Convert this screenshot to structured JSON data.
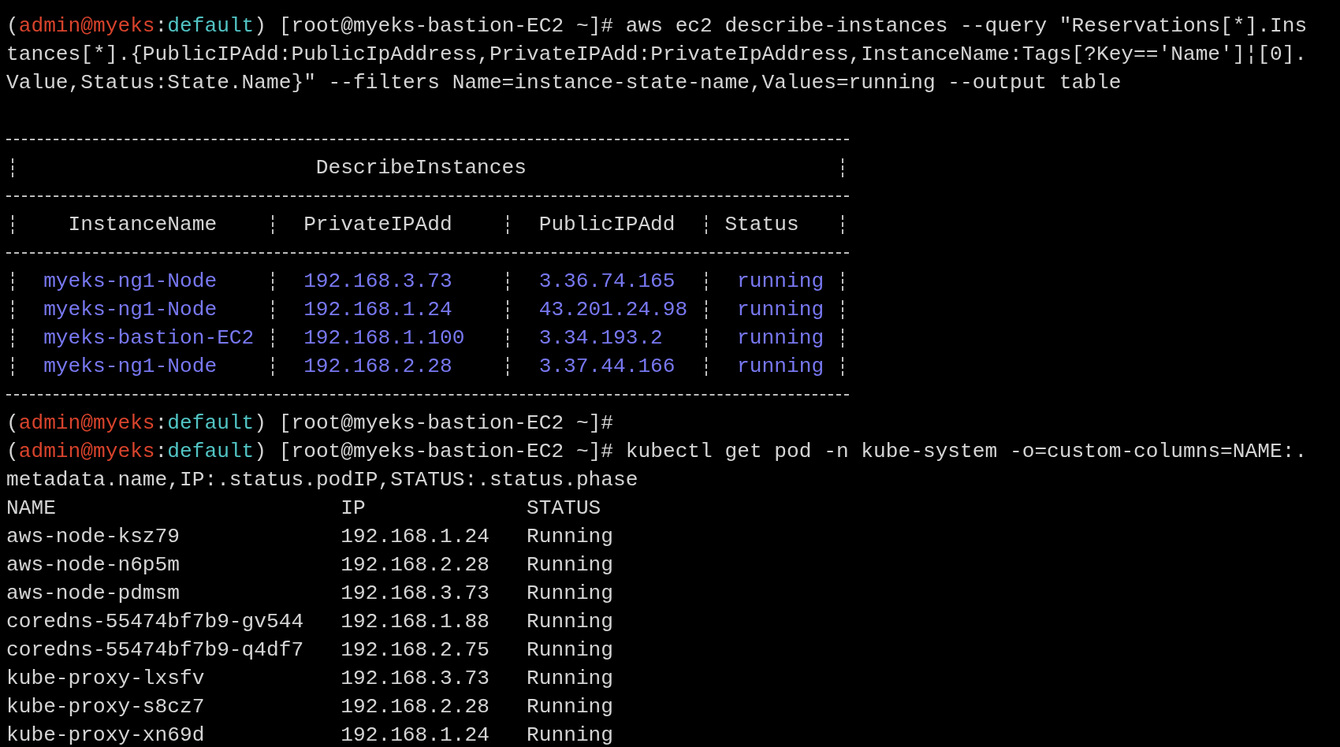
{
  "terminal": {
    "entries": [
      {
        "kind": "prompt",
        "segments": [
          {
            "text": "(",
            "color": "#d4d4d4"
          },
          {
            "text": "admin@myeks",
            "color": "#d8432c"
          },
          {
            "text": ":",
            "color": "#d4d4d4"
          },
          {
            "text": "default",
            "color": "#52c4c4"
          },
          {
            "text": ") [root@myeks-bastion-EC2 ~]# aws ec2 describe-instances --query \"Reservations[*].Ins",
            "color": "#d4d4d4"
          }
        ]
      },
      {
        "kind": "text",
        "text": "tances[*].{PublicIPAdd:PublicIpAddress,PrivateIPAdd:PrivateIpAddress,InstanceName:Tags[?Key=='Name']¦[0]."
      },
      {
        "kind": "text",
        "text": "Value,Status:State.Name}\" --filters Name=instance-state-name,Values=running --output table"
      },
      {
        "kind": "table",
        "title": "DescribeInstances",
        "columns": [
          "InstanceName",
          "PrivateIPAdd",
          "PublicIPAdd",
          "Status"
        ],
        "rows": [
          [
            "myeks-ng1-Node",
            "192.168.3.73",
            "3.36.74.165",
            "running"
          ],
          [
            "myeks-ng1-Node",
            "192.168.1.24",
            "43.201.24.98",
            "running"
          ],
          [
            "myeks-bastion-EC2",
            "192.168.1.100",
            "3.34.193.2",
            "running"
          ],
          [
            "myeks-ng1-Node",
            "192.168.2.28",
            "3.37.44.166",
            "running"
          ]
        ]
      },
      {
        "kind": "prompt",
        "segments": [
          {
            "text": "(",
            "color": "#d4d4d4"
          },
          {
            "text": "admin@myeks",
            "color": "#d8432c"
          },
          {
            "text": ":",
            "color": "#d4d4d4"
          },
          {
            "text": "default",
            "color": "#52c4c4"
          },
          {
            "text": ") [root@myeks-bastion-EC2 ~]#",
            "color": "#d4d4d4"
          }
        ]
      },
      {
        "kind": "prompt",
        "segments": [
          {
            "text": "(",
            "color": "#d4d4d4"
          },
          {
            "text": "admin@myeks",
            "color": "#d8432c"
          },
          {
            "text": ":",
            "color": "#d4d4d4"
          },
          {
            "text": "default",
            "color": "#52c4c4"
          },
          {
            "text": ") [root@myeks-bastion-EC2 ~]# kubectl get pod -n kube-system -o=custom-columns=NAME:.",
            "color": "#d4d4d4"
          }
        ]
      },
      {
        "kind": "text",
        "text": "metadata.name,IP:.status.podIP,STATUS:.status.phase"
      },
      {
        "kind": "listing",
        "columns": [
          "NAME",
          "IP",
          "STATUS"
        ],
        "rows": [
          [
            "aws-node-ksz79",
            "192.168.1.24",
            "Running"
          ],
          [
            "aws-node-n6p5m",
            "192.168.2.28",
            "Running"
          ],
          [
            "aws-node-pdmsm",
            "192.168.3.73",
            "Running"
          ],
          [
            "coredns-55474bf7b9-gv544",
            "192.168.1.88",
            "Running"
          ],
          [
            "coredns-55474bf7b9-q4df7",
            "192.168.2.75",
            "Running"
          ],
          [
            "kube-proxy-lxsfv",
            "192.168.3.73",
            "Running"
          ],
          [
            "kube-proxy-s8cz7",
            "192.168.2.28",
            "Running"
          ],
          [
            "kube-proxy-xn69d",
            "192.168.1.24",
            "Running"
          ]
        ]
      }
    ]
  }
}
